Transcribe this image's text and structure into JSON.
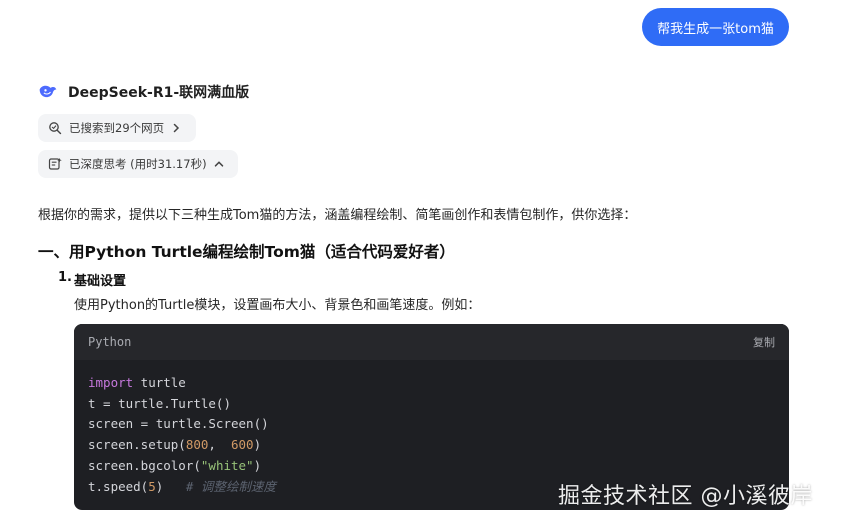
{
  "user_message": "帮我生成一张tom猫",
  "model": {
    "name": "DeepSeek-R1-联网满血版",
    "logo_icon": "deepseek-whale-icon",
    "accent_color": "#4d6bfe"
  },
  "chips": {
    "search": {
      "label": "已搜索到29个网页",
      "icon": "search-web-icon",
      "arrow_icon": "chevron-right-icon"
    },
    "think": {
      "label": "已深度思考 (用时31.17秒)",
      "icon": "think-icon",
      "arrow_icon": "chevron-up-icon"
    }
  },
  "answer": {
    "intro": "根据你的需求，提供以下三种生成Tom猫的方法，涵盖编程绘制、简笔画创作和表情包制作，供你选择：",
    "heading": "一、用Python Turtle编程绘制Tom猫（适合代码爱好者）",
    "list_item": {
      "number": "1.",
      "title": "基础设置",
      "description": "使用Python的Turtle模块，设置画布大小、背景色和画笔速度。例如："
    }
  },
  "code_block": {
    "language": "Python",
    "copy_label": "复制",
    "lines": [
      {
        "kw": "import",
        "rest": " turtle"
      },
      {
        "plain": "t = turtle.Turtle()"
      },
      {
        "plain": "screen = turtle.Screen()"
      },
      {
        "pre": "screen.setup(",
        "num1": "800",
        "mid": ",  ",
        "num2": "600",
        "post": ")"
      },
      {
        "pre": "screen.bgcolor(",
        "str": "\"white\"",
        "post": ")"
      },
      {
        "pre": "t.speed(",
        "num1": "5",
        "post": ")",
        "comment": "# 调整绘制速度"
      }
    ]
  },
  "watermark": "掘金技术社区 @小溪彼岸",
  "colors": {
    "user_bubble": "#2f6cf6",
    "chip_bg": "#f3f4f6",
    "code_bg": "#1e1f23",
    "code_header_bg": "#26272b"
  }
}
